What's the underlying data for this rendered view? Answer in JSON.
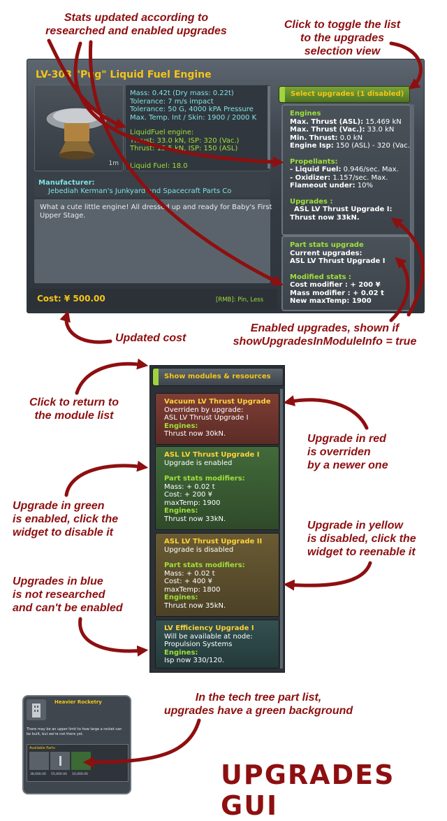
{
  "annotations": {
    "stats_updated": [
      "Stats updated according to",
      "researched and enabled upgrades"
    ],
    "toggle_list": [
      "Click to toggle the list",
      "to the upgrades",
      "selection view"
    ],
    "updated_cost": "Updated cost",
    "enabled_upgrades": [
      "Enabled upgrades, shown if",
      "showUpgradesInModuleInfo = true"
    ],
    "return_module": [
      "Click to return to",
      "the module list"
    ],
    "red_upgrade": [
      "Upgrade in red",
      "is overriden",
      "by a newer one"
    ],
    "green_upgrade": [
      "Upgrade in green",
      "is enabled, click the",
      "widget to disable it"
    ],
    "yellow_upgrade": [
      "Upgrade in yellow",
      "is disabled, click the",
      "widget to reenable it"
    ],
    "blue_upgrade": [
      "Upgrades in blue",
      "is not researched",
      "and can't be enabled"
    ],
    "tech_tree": [
      "In the tech tree part list,",
      "upgrades have a green background"
    ],
    "big_title": "UPGRADES GUI"
  },
  "part_window": {
    "title": "LV-303 \"Pug\" Liquid Fuel Engine",
    "size_label": "1m",
    "stats": [
      "Mass: 0.42t (Dry mass: 0.22t)",
      "Tolerance: 7 m/s impact",
      "Tolerance: 50 G, 4000 kPA Pressure",
      "Max. Temp. Int / Skin: 1900 / 2000 K"
    ],
    "engine_header": "LiquidFuel engine:",
    "engine_lines": [
      "Thrust: 33.0 kN, ISP: 320 (Vac.)",
      "Thrust: 15.5 kN, ISP: 150 (ASL)"
    ],
    "liquid_fuel": "Liquid Fuel: 18.0",
    "manufacturer_label": "Manufacturer:",
    "manufacturer": "Jebediah Kerman's Junkyard and Spacecraft Parts Co",
    "description": [
      "What a cute little engine! All dressed up and ready for Baby's First",
      "Upper Stage."
    ],
    "cost": "Cost: ¥ 500.00",
    "rmb": "[RMB]: Pin, Less",
    "select_button": "Select upgrades (1 disabled)",
    "engines_header": "Engines",
    "engines_lines": [
      {
        "k": "Max. Thrust (ASL):",
        "v": " 15.469 kN"
      },
      {
        "k": "Max. Thrust (Vac.):",
        "v": " 33.0 kN"
      },
      {
        "k": "Min. Thrust:",
        "v": " 0.0 kN"
      },
      {
        "k": "Engine Isp:",
        "v": " 150 (ASL) - 320 (Vac.)"
      }
    ],
    "propellants_header": "Propellants:",
    "propellant_lines": [
      {
        "k": "- Liquid Fuel:",
        "v": " 0.946/sec. Max."
      },
      {
        "k": "- Oxidizer:",
        "v": " 1.157/sec. Max."
      },
      {
        "k": "Flameout under:",
        "v": " 10%"
      }
    ],
    "upgrades_header": "Upgrades :",
    "upgrades_lines": [
      "ASL LV Thrust Upgrade I:",
      "Thrust now 33kN."
    ],
    "part_stats_header": "Part stats upgrade",
    "current_upgrades_label": "Current upgrades:",
    "current_upgrade": "ASL LV Thrust Upgrade I",
    "modified_header": "Modified stats :",
    "modified_lines": [
      "Cost modifier : + 200 ¥",
      "Mass modifier : + 0.02 t",
      "New maxTemp: 1900"
    ]
  },
  "upgrades_view": {
    "show_modules_button": "Show modules & resources",
    "items": [
      {
        "title": "Vacuum LV Thrust Upgrade",
        "lines": [
          "Overriden by upgrade:",
          "ASL LV Thrust Upgrade I"
        ],
        "engines": "Engines:",
        "engine_line": "Thrust now 30kN.",
        "color": "#7a3a33"
      },
      {
        "title": "ASL LV Thrust Upgrade I",
        "lines": [
          "Upgrade is enabled"
        ],
        "modifiers": "Part stats modifiers:",
        "mod_lines": [
          "Mass: + 0.02 t",
          "Cost: + 200 ¥",
          "maxTemp: 1900"
        ],
        "engines": "Engines:",
        "engine_line": "Thrust now 33kN.",
        "color": "#3e5a35"
      },
      {
        "title": "ASL LV Thrust Upgrade II",
        "lines": [
          "Upgrade is disabled"
        ],
        "modifiers": "Part stats modifiers:",
        "mod_lines": [
          "Mass: + 0.02 t",
          "Cost: + 400 ¥",
          "maxTemp: 1800"
        ],
        "engines": "Engines:",
        "engine_line": "Thrust now 35kN.",
        "color": "#5e5330"
      },
      {
        "title": "LV Efficiency Upgrade I",
        "lines": [
          "Will be available at node:",
          "Propulsion Systems"
        ],
        "engines": "Engines:",
        "engine_line": "Isp now 330/120.",
        "color": "#2d4447"
      }
    ]
  },
  "tech_tree": {
    "title": "Heavier Rocketry",
    "description": "There may be an upper limit to how large a rocket can be built, but we're not there yet.",
    "available_parts": "Available Parts",
    "prices": [
      "38,000.00",
      "55,000.00",
      "10,000.00"
    ]
  }
}
